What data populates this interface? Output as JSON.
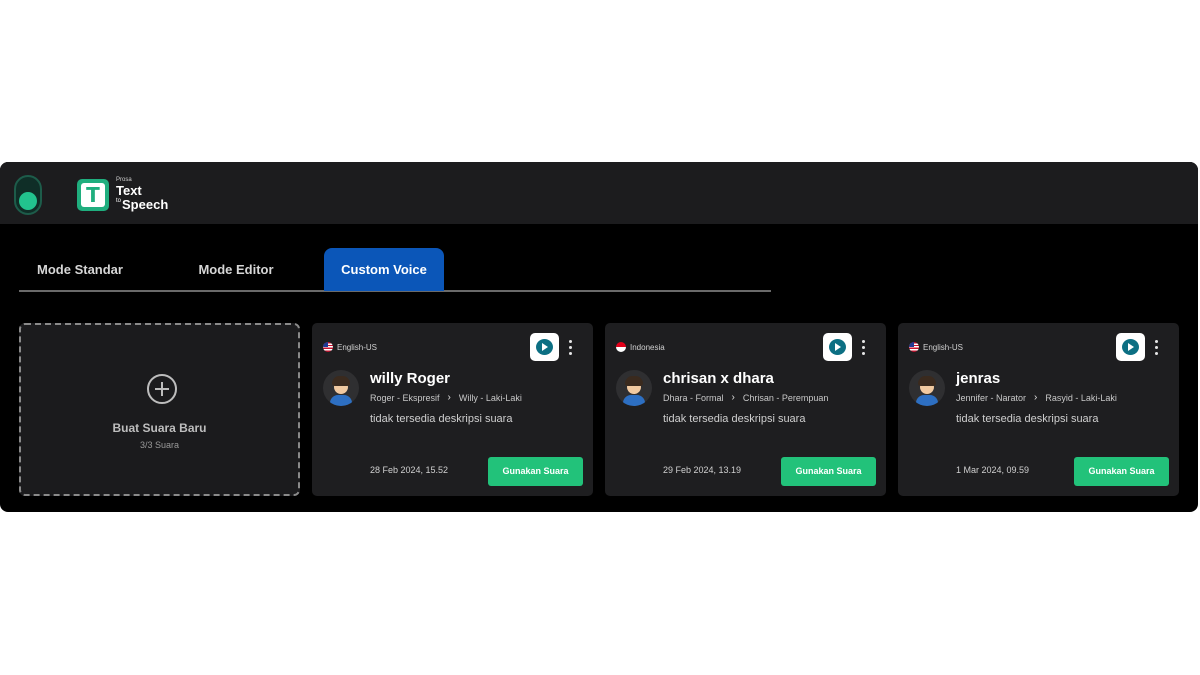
{
  "app": {
    "brand": "Prosa",
    "logo_letter": "T",
    "title_line1": "Text",
    "title_line2_small": "to",
    "title_line2": "Speech"
  },
  "tabs": [
    {
      "label": "Mode Standar",
      "active": false
    },
    {
      "label": "Mode Editor",
      "active": false
    },
    {
      "label": "Custom Voice",
      "active": true
    }
  ],
  "new_voice": {
    "icon": "plus-circle-icon",
    "title": "Buat Suara Baru",
    "subtitle": "3/3 Suara"
  },
  "voices": [
    {
      "language": "English-US",
      "flag": "us-flag-icon",
      "name": "willy Roger",
      "style_from": "Roger - Ekspresif",
      "style_to": "Willy - Laki-Laki",
      "description": "tidak tersedia deskripsi suara",
      "date": "28 Feb 2024, 15.52",
      "use_label": "Gunakan Suara"
    },
    {
      "language": "Indonesia",
      "flag": "id-flag-icon",
      "name": "chrisan x dhara",
      "style_from": "Dhara - Formal",
      "style_to": "Chrisan - Perempuan",
      "description": "tidak tersedia deskripsi suara",
      "date": "29 Feb 2024, 13.19",
      "use_label": "Gunakan Suara"
    },
    {
      "language": "English-US",
      "flag": "us-flag-icon",
      "name": "jenras",
      "style_from": "Jennifer - Narator",
      "style_to": "Rasyid - Laki-Laki",
      "description": "tidak tersedia deskripsi suara",
      "date": "1 Mar 2024, 09.59",
      "use_label": "Gunakan Suara"
    }
  ],
  "colors": {
    "accent_green": "#22c27a",
    "active_tab": "#0b56b8",
    "play_icon": "#0c6f83"
  }
}
